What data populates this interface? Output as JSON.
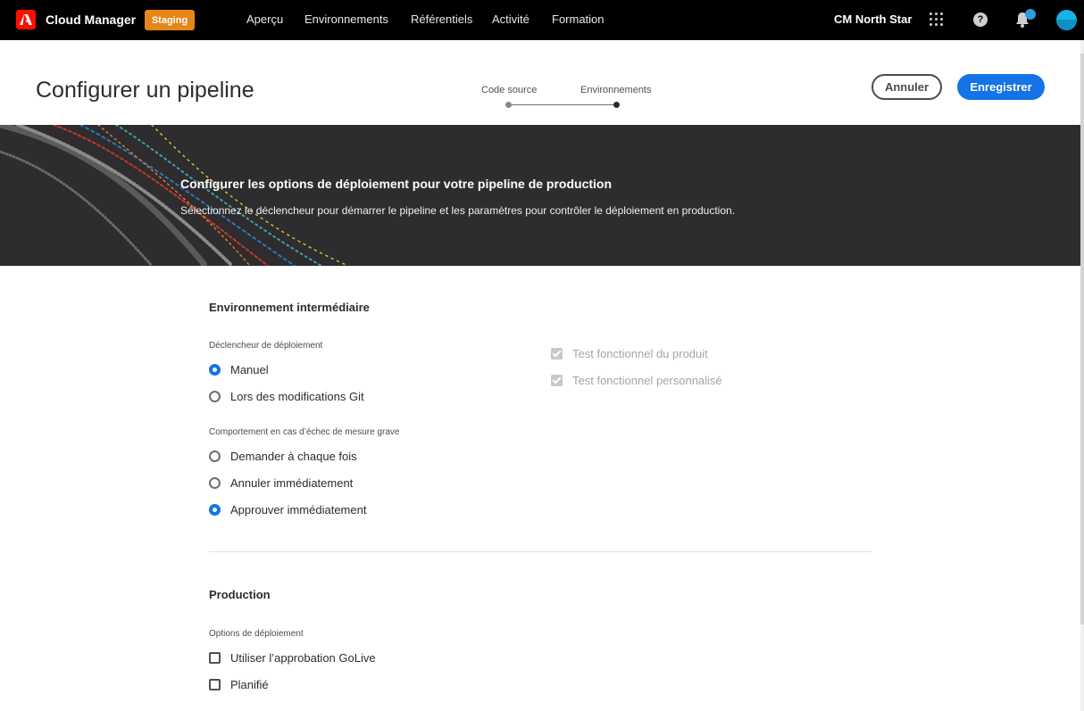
{
  "topbar": {
    "app_title": "Cloud Manager",
    "badge": "Staging",
    "nav": [
      "Aperçu",
      "Environnements",
      "Référentiels",
      "Activité",
      "Formation"
    ],
    "org_name": "CM North Star",
    "icons": [
      "adobe-logo-icon",
      "apps-grid-icon",
      "help-icon",
      "bell-icon",
      "avatar-icon"
    ],
    "help_glyph": "?"
  },
  "header": {
    "title": "Configurer un pipeline",
    "steps": [
      "Code source",
      "Environnements"
    ],
    "active_step": 2,
    "cancel_label": "Annuler",
    "save_label": "Enregistrer"
  },
  "banner": {
    "title": "Configurer les options de déploiement pour votre pipeline de production",
    "subtitle": "Sélectionnez le déclencheur pour démarrer le pipeline et les paramètres pour contrôler le déploiement en production."
  },
  "staging": {
    "title": "Environnement intermédiaire",
    "trigger_label": "Déclencheur de déploiement",
    "trigger_options": [
      {
        "label": "Manuel",
        "selected": true
      },
      {
        "label": "Lors des modifications Git",
        "selected": false
      }
    ],
    "failure_label": "Comportement en cas d’échec de mesure grave",
    "failure_options": [
      {
        "label": "Demander à chaque fois",
        "selected": false
      },
      {
        "label": "Annuler immédiatement",
        "selected": false
      },
      {
        "label": "Approuver immédiatement",
        "selected": true
      }
    ],
    "tests": [
      {
        "label": "Test fonctionnel du produit",
        "checked": true,
        "disabled": true
      },
      {
        "label": "Test fonctionnel personnalisé",
        "checked": true,
        "disabled": true
      }
    ]
  },
  "production": {
    "title": "Production",
    "options_label": "Options de déploiement",
    "options": [
      {
        "label": "Utiliser l’approbation GoLive",
        "checked": false
      },
      {
        "label": "Planifié",
        "checked": false
      }
    ]
  },
  "colors": {
    "accent": "#1473e6",
    "staging_badge": "#e68619",
    "adobe_red": "#fa0f00",
    "banner_bg": "#2e2c2f"
  }
}
